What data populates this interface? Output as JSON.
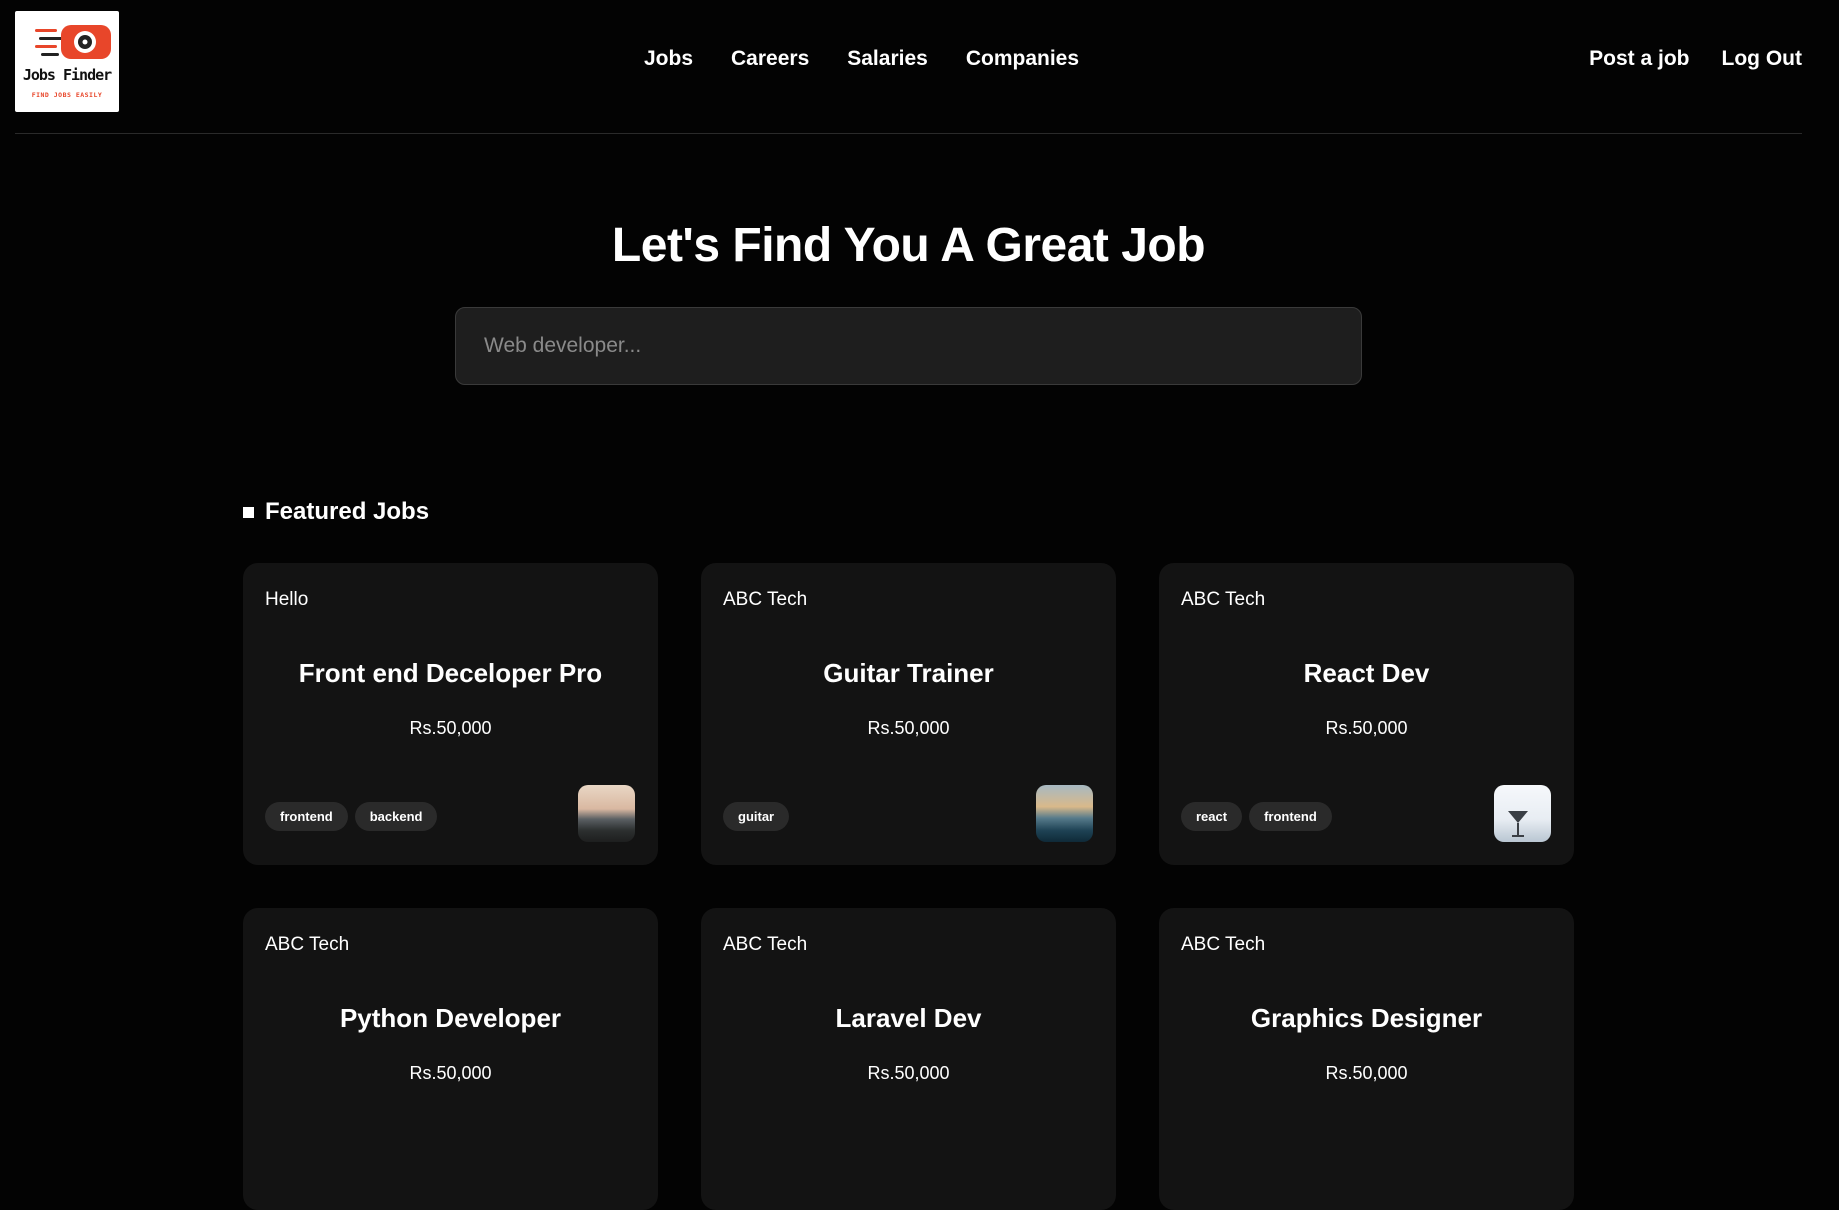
{
  "brand": {
    "name": "Jobs Finder",
    "tagline": "FIND JOBS EASILY",
    "accent": "#e8462a"
  },
  "nav": {
    "links": [
      "Jobs",
      "Careers",
      "Salaries",
      "Companies"
    ],
    "actions": [
      "Post a job",
      "Log Out"
    ]
  },
  "hero": {
    "title": "Let's Find You A Great Job",
    "search_placeholder": "Web developer..."
  },
  "featured": {
    "heading": "Featured Jobs",
    "jobs": [
      {
        "company": "Hello",
        "title": "Front end Deceloper Pro",
        "salary": "Rs.50,000",
        "tags": [
          "frontend",
          "backend"
        ],
        "thumb": "landscape-photo"
      },
      {
        "company": "ABC Tech",
        "title": "Guitar Trainer",
        "salary": "Rs.50,000",
        "tags": [
          "guitar"
        ],
        "thumb": "ocean-photo"
      },
      {
        "company": "ABC Tech",
        "title": "React Dev",
        "salary": "Rs.50,000",
        "tags": [
          "react",
          "frontend"
        ],
        "thumb": "drink-photo"
      },
      {
        "company": "ABC Tech",
        "title": "Python Developer",
        "salary": "Rs.50,000",
        "tags": [],
        "thumb": ""
      },
      {
        "company": "ABC Tech",
        "title": "Laravel Dev",
        "salary": "Rs.50,000",
        "tags": [],
        "thumb": ""
      },
      {
        "company": "ABC Tech",
        "title": "Graphics Designer",
        "salary": "Rs.50,000",
        "tags": [],
        "thumb": ""
      }
    ]
  }
}
